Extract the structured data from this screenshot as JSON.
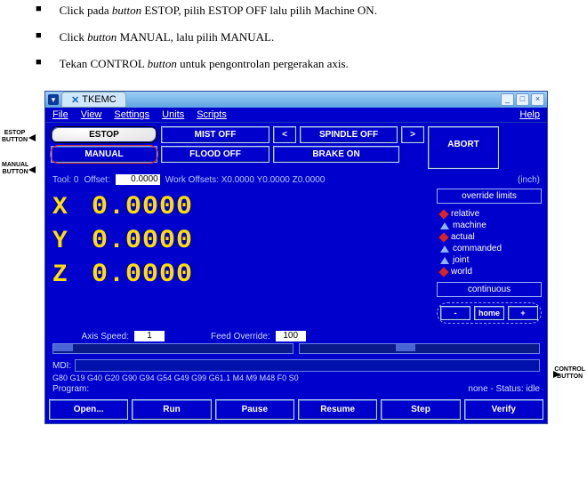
{
  "doc": {
    "items": [
      "Click pada <i>button</i>  ESTOP, pilih ESTOP OFF lalu pilih Machine ON.",
      "Click <i>button</i> MANUAL, lalu pilih MANUAL.",
      "Tekan CONTROL <i>button</i> untuk pengontrolan pergerakan axis."
    ]
  },
  "labels": {
    "estop": "ESTOP\nBUTTON",
    "manual": "MANUAL\nBUTTON",
    "control": "CONTROL\nBUTTON"
  },
  "titlebar": {
    "app": "TKEMC"
  },
  "menu": {
    "file": "File",
    "view": "View",
    "settings": "Settings",
    "units": "Units",
    "scripts": "Scripts",
    "help": "Help"
  },
  "buttons": {
    "estop": "ESTOP",
    "manual": "MANUAL",
    "mist": "MIST OFF",
    "flood": "FLOOD OFF",
    "left": "<",
    "spindle": "SPINDLE OFF",
    "right": ">",
    "brake": "BRAKE ON",
    "abort": "ABORT"
  },
  "infoline": {
    "tool": "Tool:  0",
    "offset_lbl": "Offset:",
    "offset_val": "0.0000",
    "workoff": "Work Offsets:   X0.0000 Y0.0000 Z0.0000",
    "unit": "(inch)"
  },
  "dro": {
    "x": {
      "axis": "X",
      "val": "0.0000"
    },
    "y": {
      "axis": "Y",
      "val": "0.0000"
    },
    "z": {
      "axis": "Z",
      "val": "0.0000"
    }
  },
  "right": {
    "override": "override limits",
    "items": [
      "relative",
      "machine",
      "actual",
      "commanded",
      "joint",
      "world"
    ],
    "shapes": [
      "red",
      "up",
      "red",
      "up",
      "up",
      "red"
    ],
    "continuous": "continuous",
    "home": "home"
  },
  "sliders": {
    "axis_lbl": "Axis Speed:",
    "axis_val": "1",
    "feed_lbl": "Feed Override:",
    "feed_val": "100"
  },
  "mdi": {
    "label": "MDI:"
  },
  "gcodes": "G80 G19 G40 G20 G90 G94 G54 G49 G99 G61.1 M4 M9 M48 F0 S0",
  "program": {
    "label": "Program:",
    "status": "none   -   Status:   idle"
  },
  "bottom": [
    "Open...",
    "Run",
    "Pause",
    "Resume",
    "Step",
    "Verify"
  ]
}
